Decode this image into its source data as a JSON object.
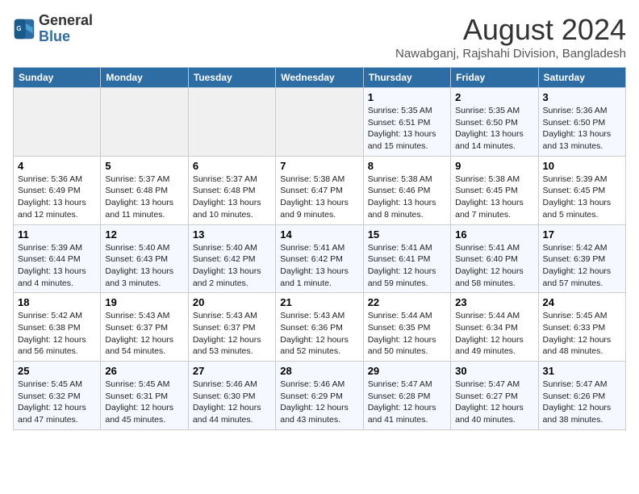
{
  "header": {
    "logo_line1": "General",
    "logo_line2": "Blue",
    "title": "August 2024",
    "subtitle": "Nawabganj, Rajshahi Division, Bangladesh"
  },
  "days_of_week": [
    "Sunday",
    "Monday",
    "Tuesday",
    "Wednesday",
    "Thursday",
    "Friday",
    "Saturday"
  ],
  "weeks": [
    [
      {
        "day": "",
        "text": ""
      },
      {
        "day": "",
        "text": ""
      },
      {
        "day": "",
        "text": ""
      },
      {
        "day": "",
        "text": ""
      },
      {
        "day": "1",
        "text": "Sunrise: 5:35 AM\nSunset: 6:51 PM\nDaylight: 13 hours and 15 minutes."
      },
      {
        "day": "2",
        "text": "Sunrise: 5:35 AM\nSunset: 6:50 PM\nDaylight: 13 hours and 14 minutes."
      },
      {
        "day": "3",
        "text": "Sunrise: 5:36 AM\nSunset: 6:50 PM\nDaylight: 13 hours and 13 minutes."
      }
    ],
    [
      {
        "day": "4",
        "text": "Sunrise: 5:36 AM\nSunset: 6:49 PM\nDaylight: 13 hours and 12 minutes."
      },
      {
        "day": "5",
        "text": "Sunrise: 5:37 AM\nSunset: 6:48 PM\nDaylight: 13 hours and 11 minutes."
      },
      {
        "day": "6",
        "text": "Sunrise: 5:37 AM\nSunset: 6:48 PM\nDaylight: 13 hours and 10 minutes."
      },
      {
        "day": "7",
        "text": "Sunrise: 5:38 AM\nSunset: 6:47 PM\nDaylight: 13 hours and 9 minutes."
      },
      {
        "day": "8",
        "text": "Sunrise: 5:38 AM\nSunset: 6:46 PM\nDaylight: 13 hours and 8 minutes."
      },
      {
        "day": "9",
        "text": "Sunrise: 5:38 AM\nSunset: 6:45 PM\nDaylight: 13 hours and 7 minutes."
      },
      {
        "day": "10",
        "text": "Sunrise: 5:39 AM\nSunset: 6:45 PM\nDaylight: 13 hours and 5 minutes."
      }
    ],
    [
      {
        "day": "11",
        "text": "Sunrise: 5:39 AM\nSunset: 6:44 PM\nDaylight: 13 hours and 4 minutes."
      },
      {
        "day": "12",
        "text": "Sunrise: 5:40 AM\nSunset: 6:43 PM\nDaylight: 13 hours and 3 minutes."
      },
      {
        "day": "13",
        "text": "Sunrise: 5:40 AM\nSunset: 6:42 PM\nDaylight: 13 hours and 2 minutes."
      },
      {
        "day": "14",
        "text": "Sunrise: 5:41 AM\nSunset: 6:42 PM\nDaylight: 13 hours and 1 minute."
      },
      {
        "day": "15",
        "text": "Sunrise: 5:41 AM\nSunset: 6:41 PM\nDaylight: 12 hours and 59 minutes."
      },
      {
        "day": "16",
        "text": "Sunrise: 5:41 AM\nSunset: 6:40 PM\nDaylight: 12 hours and 58 minutes."
      },
      {
        "day": "17",
        "text": "Sunrise: 5:42 AM\nSunset: 6:39 PM\nDaylight: 12 hours and 57 minutes."
      }
    ],
    [
      {
        "day": "18",
        "text": "Sunrise: 5:42 AM\nSunset: 6:38 PM\nDaylight: 12 hours and 56 minutes."
      },
      {
        "day": "19",
        "text": "Sunrise: 5:43 AM\nSunset: 6:37 PM\nDaylight: 12 hours and 54 minutes."
      },
      {
        "day": "20",
        "text": "Sunrise: 5:43 AM\nSunset: 6:37 PM\nDaylight: 12 hours and 53 minutes."
      },
      {
        "day": "21",
        "text": "Sunrise: 5:43 AM\nSunset: 6:36 PM\nDaylight: 12 hours and 52 minutes."
      },
      {
        "day": "22",
        "text": "Sunrise: 5:44 AM\nSunset: 6:35 PM\nDaylight: 12 hours and 50 minutes."
      },
      {
        "day": "23",
        "text": "Sunrise: 5:44 AM\nSunset: 6:34 PM\nDaylight: 12 hours and 49 minutes."
      },
      {
        "day": "24",
        "text": "Sunrise: 5:45 AM\nSunset: 6:33 PM\nDaylight: 12 hours and 48 minutes."
      }
    ],
    [
      {
        "day": "25",
        "text": "Sunrise: 5:45 AM\nSunset: 6:32 PM\nDaylight: 12 hours and 47 minutes."
      },
      {
        "day": "26",
        "text": "Sunrise: 5:45 AM\nSunset: 6:31 PM\nDaylight: 12 hours and 45 minutes."
      },
      {
        "day": "27",
        "text": "Sunrise: 5:46 AM\nSunset: 6:30 PM\nDaylight: 12 hours and 44 minutes."
      },
      {
        "day": "28",
        "text": "Sunrise: 5:46 AM\nSunset: 6:29 PM\nDaylight: 12 hours and 43 minutes."
      },
      {
        "day": "29",
        "text": "Sunrise: 5:47 AM\nSunset: 6:28 PM\nDaylight: 12 hours and 41 minutes."
      },
      {
        "day": "30",
        "text": "Sunrise: 5:47 AM\nSunset: 6:27 PM\nDaylight: 12 hours and 40 minutes."
      },
      {
        "day": "31",
        "text": "Sunrise: 5:47 AM\nSunset: 6:26 PM\nDaylight: 12 hours and 38 minutes."
      }
    ]
  ]
}
